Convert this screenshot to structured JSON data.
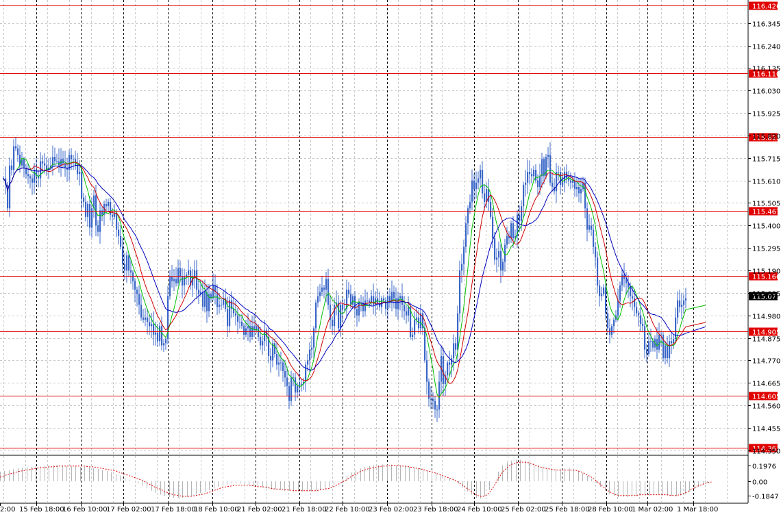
{
  "colors": {
    "background": "#ffffff",
    "grid": "#c8c8c8",
    "separator": "#000000",
    "candle": "#3a67c8",
    "level_line": "#e00000",
    "level_label_bg": "#e00000",
    "level_label_text": "#ffffff",
    "ma_fast": "#00c000",
    "ma_mid": "#d00000",
    "ma_slow": "#0000c0",
    "osc_hist": "#b4b4b4",
    "osc_signal": "#e00000",
    "current_label_bg": "#000000",
    "current_label_text": "#ffffff",
    "axis_text": "#000000"
  },
  "chart_data": {
    "type": "candlestick",
    "title": "",
    "price_axis": {
      "ylim": [
        114.33,
        116.44
      ],
      "ticks": [
        "116.345",
        "116.240",
        "116.135",
        "116.030",
        "115.925",
        "115.820",
        "115.715",
        "115.610",
        "115.505",
        "115.400",
        "115.295",
        "115.190",
        "115.085",
        "114.980",
        "114.875",
        "114.770",
        "114.665",
        "114.560",
        "114.455",
        "114.350"
      ]
    },
    "levels": [
      "116.426",
      "116.110",
      "115.813",
      "115.467",
      "115.166",
      "114.905",
      "114.605",
      "114.363"
    ],
    "current_price": "115.071",
    "time_axis": {
      "labels": [
        "2:00",
        "15 Feb 18:00",
        "16 Feb 10:00",
        "17 Feb 02:00",
        "17 Feb 18:00",
        "18 Feb 10:00",
        "21 Feb 02:00",
        "21 Feb 18:00",
        "22 Feb 10:00",
        "23 Feb 02:00",
        "23 Feb 18:00",
        "24 Feb 10:00",
        "25 Feb 02:00",
        "25 Feb 18:00",
        "28 Feb 10:00",
        "1 Mar 02:00",
        "1 Mar 18:00"
      ]
    },
    "series": [
      {
        "type": "candlestick",
        "x": [
          0,
          3,
          6,
          9,
          12,
          15,
          18,
          21,
          24,
          27,
          30,
          33,
          36,
          39,
          42,
          45,
          48,
          51,
          54,
          57,
          60,
          63,
          66,
          69,
          72,
          75,
          78,
          81,
          84,
          87,
          90,
          93,
          96,
          99,
          102,
          105,
          108,
          111,
          114,
          117,
          120,
          123,
          126,
          129,
          132,
          135,
          138,
          141,
          144,
          147,
          150,
          153,
          156,
          159,
          162,
          165,
          168,
          171,
          174,
          177,
          180,
          183,
          186,
          189,
          192,
          195,
          198,
          201,
          204,
          207,
          210,
          213,
          216,
          219,
          222,
          225,
          228,
          231,
          234,
          237,
          240,
          243,
          246,
          249,
          252,
          255,
          258,
          261,
          264,
          267,
          270,
          273,
          276,
          279,
          282,
          285,
          288,
          291,
          294,
          297,
          300,
          303,
          306,
          309,
          312,
          315,
          318,
          321,
          324,
          327,
          330,
          333,
          336,
          339,
          342,
          345,
          348,
          351,
          354,
          357,
          360,
          363,
          366,
          369,
          372,
          375,
          378,
          381,
          384,
          387,
          390,
          393,
          396,
          399,
          402,
          405,
          408,
          411,
          414,
          417,
          420,
          423,
          426,
          429,
          432,
          435,
          438,
          441,
          444,
          447,
          450,
          453,
          456,
          459,
          462,
          465,
          468,
          471,
          474,
          477,
          480,
          483,
          486,
          489,
          492,
          495,
          498,
          501,
          504,
          507,
          510,
          513,
          516,
          519,
          522,
          525,
          528,
          531,
          534,
          537,
          540,
          543,
          546,
          549,
          552,
          555,
          558,
          561,
          564,
          567,
          570,
          573,
          576,
          579,
          582,
          585,
          588,
          591,
          594,
          597,
          600,
          603,
          606,
          609,
          612,
          615,
          618,
          621,
          624,
          627,
          630,
          633,
          636,
          639,
          642,
          645,
          648,
          651,
          654,
          657,
          660,
          663,
          666,
          669,
          672,
          675,
          678,
          681,
          684,
          687,
          690,
          693,
          696,
          699,
          702,
          705,
          708,
          711,
          714,
          717,
          720,
          723,
          726,
          729,
          732,
          735,
          738,
          741,
          744,
          747,
          750,
          753,
          756,
          759,
          762,
          765,
          768,
          771,
          774,
          777,
          780,
          783,
          786,
          789,
          792,
          795,
          798,
          801,
          804,
          807,
          810,
          813,
          816,
          819,
          822,
          825,
          828,
          831,
          834,
          837,
          840,
          843,
          846,
          849,
          852,
          855,
          858,
          861,
          864,
          867,
          870,
          873,
          876,
          879,
          882,
          885,
          888,
          891,
          894,
          897,
          900,
          903,
          906,
          909,
          912,
          915,
          918,
          921,
          924,
          927,
          930,
          933,
          936,
          939,
          942,
          945,
          948,
          951,
          954,
          957,
          960,
          963,
          966,
          969,
          972,
          975,
          978,
          981,
          984,
          987,
          990,
          993,
          996,
          999,
          1002,
          1005,
          1008,
          1011,
          1014,
          1017,
          1020,
          1023,
          1026,
          1029,
          1032,
          1035,
          1038,
          1041
        ],
        "close": [
          115.62,
          115.59,
          115.48,
          115.68,
          115.66,
          115.77,
          115.76,
          115.73,
          115.68,
          115.71,
          115.67,
          115.64,
          115.63,
          115.62,
          115.6,
          115.66,
          115.63,
          115.62,
          115.7,
          115.69,
          115.68,
          115.66,
          115.67,
          115.68,
          115.72,
          115.7,
          115.7,
          115.68,
          115.71,
          115.69,
          115.67,
          115.66,
          115.73,
          115.71,
          115.71,
          115.68,
          115.64,
          115.65,
          115.53,
          115.51,
          115.44,
          115.5,
          115.39,
          115.48,
          115.54,
          115.4,
          115.37,
          115.47,
          115.45,
          115.5,
          115.49,
          115.51,
          115.45,
          115.44,
          115.46,
          115.38,
          115.35,
          115.3,
          115.22,
          115.19,
          115.26,
          115.19,
          115.18,
          115.14,
          115.1,
          115.08,
          115.03,
          114.97,
          114.96,
          114.97,
          114.95,
          114.93,
          114.94,
          114.89,
          114.9,
          114.86,
          114.93,
          114.84,
          114.85,
          114.87,
          115.07,
          115.16,
          115.14,
          115.15,
          115.13,
          115.2,
          115.16,
          115.12,
          115.16,
          115.17,
          115.19,
          115.12,
          115.16,
          115.19,
          115.1,
          115.08,
          115.09,
          115.02,
          115.09,
          115.0,
          115.08,
          115.06,
          115.12,
          115.09,
          115.02,
          115.03,
          115.03,
          115.06,
          115.01,
          114.93,
          115.05,
          115.01,
          114.99,
          114.98,
          114.95,
          114.95,
          114.93,
          114.89,
          114.92,
          114.93,
          114.88,
          114.93,
          114.91,
          114.93,
          114.88,
          114.84,
          114.86,
          114.91,
          114.88,
          114.79,
          114.77,
          114.85,
          114.8,
          114.75,
          114.76,
          114.76,
          114.72,
          114.69,
          114.65,
          114.58,
          114.69,
          114.69,
          114.62,
          114.65,
          114.66,
          114.66,
          114.67,
          114.75,
          114.77,
          114.82,
          114.83,
          114.92,
          115.04,
          115.07,
          115.09,
          115.11,
          115.1,
          115.15,
          115.03,
          114.96,
          114.93,
          115.03,
          115.04,
          114.92,
          115.03,
          115.01,
          115.01,
          115.1,
          115.08,
          115.03,
          115.07,
          115.01,
          114.98,
          115.04,
          115.04,
          115.0,
          115.05,
          115.05,
          115.04,
          115.07,
          115.03,
          115.06,
          115.04,
          115.02,
          115.06,
          115.05,
          115.01,
          115.07,
          115.04,
          115.09,
          115.06,
          115.01,
          115.06,
          115.07,
          115.03,
          115.0,
          114.98,
          115.02,
          114.88,
          114.89,
          114.96,
          114.97,
          114.92,
          114.99,
          114.92,
          114.77,
          114.67,
          114.59,
          114.59,
          114.58,
          114.54,
          114.54,
          114.67,
          114.79,
          114.66,
          114.7,
          114.76,
          114.75,
          114.78,
          114.85,
          114.82,
          114.99,
          115.19,
          115.22,
          115.3,
          115.41,
          115.48,
          115.51,
          115.61,
          115.57,
          115.6,
          115.62,
          115.66,
          115.55,
          115.51,
          115.57,
          115.51,
          115.44,
          115.34,
          115.24,
          115.25,
          115.28,
          115.19,
          115.23,
          115.31,
          115.35,
          115.34,
          115.41,
          115.34,
          115.35,
          115.45,
          115.42,
          115.49,
          115.59,
          115.6,
          115.65,
          115.64,
          115.63,
          115.66,
          115.61,
          115.58,
          115.63,
          115.71,
          115.63,
          115.72,
          115.73,
          115.6,
          115.58,
          115.56,
          115.65,
          115.65,
          115.59,
          115.6,
          115.65,
          115.62,
          115.61,
          115.6,
          115.61,
          115.57,
          115.58,
          115.55,
          115.57,
          115.6,
          115.48,
          115.38,
          115.4,
          115.38,
          115.3,
          115.25,
          115.12,
          115.07,
          115.08,
          115.11,
          114.99,
          114.92,
          114.89,
          114.93,
          114.96,
          114.98,
          115.05,
          115.12,
          115.17,
          115.15,
          115.13,
          115.11,
          115.07,
          115.06,
          115.02,
          114.99,
          114.98,
          114.94,
          114.93,
          114.82,
          114.8,
          114.86,
          114.86,
          114.83,
          114.87,
          114.82,
          114.89,
          114.89,
          114.78,
          114.84,
          114.78,
          114.86,
          114.85,
          114.87,
          114.97,
          115.05,
          115.02,
          115.03,
          115.05,
          115.06
        ]
      }
    ],
    "indicator": {
      "ticks": [
        "0.1976",
        "0.00",
        "-0.1847"
      ],
      "range": [
        -0.26,
        0.3
      ],
      "histogram": [
        0.12,
        0.13,
        0.14,
        0.15,
        0.16,
        0.17,
        0.18,
        0.18,
        0.19,
        0.19,
        0.19,
        0.2,
        0.2,
        0.2,
        0.2,
        0.19,
        0.19,
        0.19,
        0.18,
        0.18,
        0.17,
        0.16,
        0.15,
        0.14,
        0.13,
        0.11,
        0.09,
        0.07,
        0.04,
        0.02,
        0.0,
        -0.03,
        -0.06,
        -0.09,
        -0.12,
        -0.15,
        -0.17,
        -0.19,
        -0.2,
        -0.21,
        -0.21,
        -0.21,
        -0.2,
        -0.19,
        -0.17,
        -0.15,
        -0.13,
        -0.11,
        -0.09,
        -0.07,
        -0.05,
        -0.04,
        -0.03,
        -0.03,
        -0.03,
        -0.04,
        -0.05,
        -0.06,
        -0.07,
        -0.08,
        -0.09,
        -0.1,
        -0.1,
        -0.11,
        -0.12,
        -0.12,
        -0.13,
        -0.13,
        -0.13,
        -0.13,
        -0.13,
        -0.12,
        -0.11,
        -0.1,
        -0.08,
        -0.05,
        -0.01,
        0.03,
        0.07,
        0.11,
        0.14,
        0.16,
        0.18,
        0.19,
        0.2,
        0.2,
        0.21,
        0.21,
        0.21,
        0.2,
        0.2,
        0.19,
        0.18,
        0.17,
        0.16,
        0.15,
        0.13,
        0.12,
        0.1,
        0.08,
        0.06,
        0.04,
        0.01,
        -0.03,
        -0.08,
        -0.13,
        -0.17,
        -0.21,
        -0.22,
        -0.19,
        -0.11,
        0.0,
        0.12,
        0.2,
        0.24,
        0.26,
        0.27,
        0.27,
        0.26,
        0.24,
        0.22,
        0.2,
        0.18,
        0.17,
        0.16,
        0.15,
        0.15,
        0.16,
        0.16,
        0.15,
        0.13,
        0.1,
        0.07,
        0.03,
        -0.02,
        -0.07,
        -0.12,
        -0.16,
        -0.19,
        -0.2,
        -0.2,
        -0.2,
        -0.19,
        -0.19,
        -0.18,
        -0.18,
        -0.18,
        -0.17,
        -0.17,
        -0.18,
        -0.18,
        -0.19,
        -0.19,
        -0.18,
        -0.16,
        -0.13,
        -0.1,
        -0.07,
        -0.04,
        -0.02,
        0.0
      ],
      "signal": [
        0.05,
        0.07,
        0.09,
        0.1,
        0.12,
        0.13,
        0.14,
        0.15,
        0.16,
        0.17,
        0.17,
        0.18,
        0.18,
        0.19,
        0.19,
        0.19,
        0.19,
        0.19,
        0.19,
        0.19,
        0.18,
        0.18,
        0.17,
        0.16,
        0.15,
        0.14,
        0.13,
        0.11,
        0.09,
        0.07,
        0.05,
        0.03,
        0.01,
        -0.02,
        -0.05,
        -0.08,
        -0.1,
        -0.13,
        -0.15,
        -0.17,
        -0.18,
        -0.19,
        -0.19,
        -0.19,
        -0.18,
        -0.17,
        -0.16,
        -0.14,
        -0.12,
        -0.1,
        -0.08,
        -0.07,
        -0.06,
        -0.05,
        -0.05,
        -0.05,
        -0.05,
        -0.06,
        -0.07,
        -0.07,
        -0.08,
        -0.09,
        -0.1,
        -0.1,
        -0.11,
        -0.11,
        -0.12,
        -0.12,
        -0.12,
        -0.12,
        -0.12,
        -0.12,
        -0.11,
        -0.1,
        -0.09,
        -0.07,
        -0.04,
        -0.01,
        0.02,
        0.06,
        0.09,
        0.12,
        0.14,
        0.16,
        0.17,
        0.18,
        0.19,
        0.19,
        0.2,
        0.2,
        0.19,
        0.19,
        0.18,
        0.17,
        0.16,
        0.15,
        0.13,
        0.12,
        0.1,
        0.08,
        0.06,
        0.04,
        0.02,
        -0.01,
        -0.05,
        -0.09,
        -0.13,
        -0.17,
        -0.19,
        -0.19,
        -0.15,
        -0.07,
        0.03,
        0.11,
        0.17,
        0.21,
        0.23,
        0.24,
        0.24,
        0.23,
        0.21,
        0.19,
        0.17,
        0.16,
        0.15,
        0.14,
        0.14,
        0.14,
        0.14,
        0.14,
        0.13,
        0.11,
        0.08,
        0.05,
        0.01,
        -0.04,
        -0.09,
        -0.13,
        -0.16,
        -0.18,
        -0.18,
        -0.18,
        -0.18,
        -0.18,
        -0.17,
        -0.17,
        -0.17,
        -0.17,
        -0.17,
        -0.17,
        -0.17,
        -0.18,
        -0.18,
        -0.17,
        -0.15,
        -0.12,
        -0.09,
        -0.06,
        -0.04,
        -0.02,
        -0.01
      ]
    }
  }
}
